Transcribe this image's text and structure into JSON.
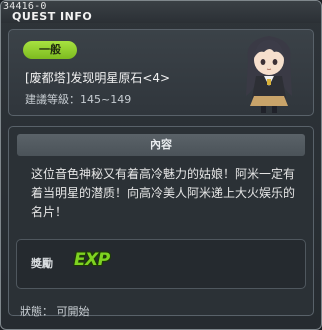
{
  "window": {
    "id": "34416-0",
    "title": "QUEST INFO"
  },
  "quest": {
    "category": "一般",
    "name": "[废都塔]发现明星原石<4>",
    "level_label": "建議等級：145~149"
  },
  "content": {
    "header": "內容",
    "text": "这位音色神秘又有着高冷魅力的姑娘！阿米一定有着当明星的潜质！向高冷美人阿米递上大火娱乐的名片！"
  },
  "reward": {
    "label": "獎勵",
    "item_icon_text": "EXP"
  },
  "status_text": "狀態： 可開始",
  "colors": {
    "badge_green": "#8fcd2d",
    "exp_green": "#7ed321",
    "panel_bg": "#333a40"
  }
}
